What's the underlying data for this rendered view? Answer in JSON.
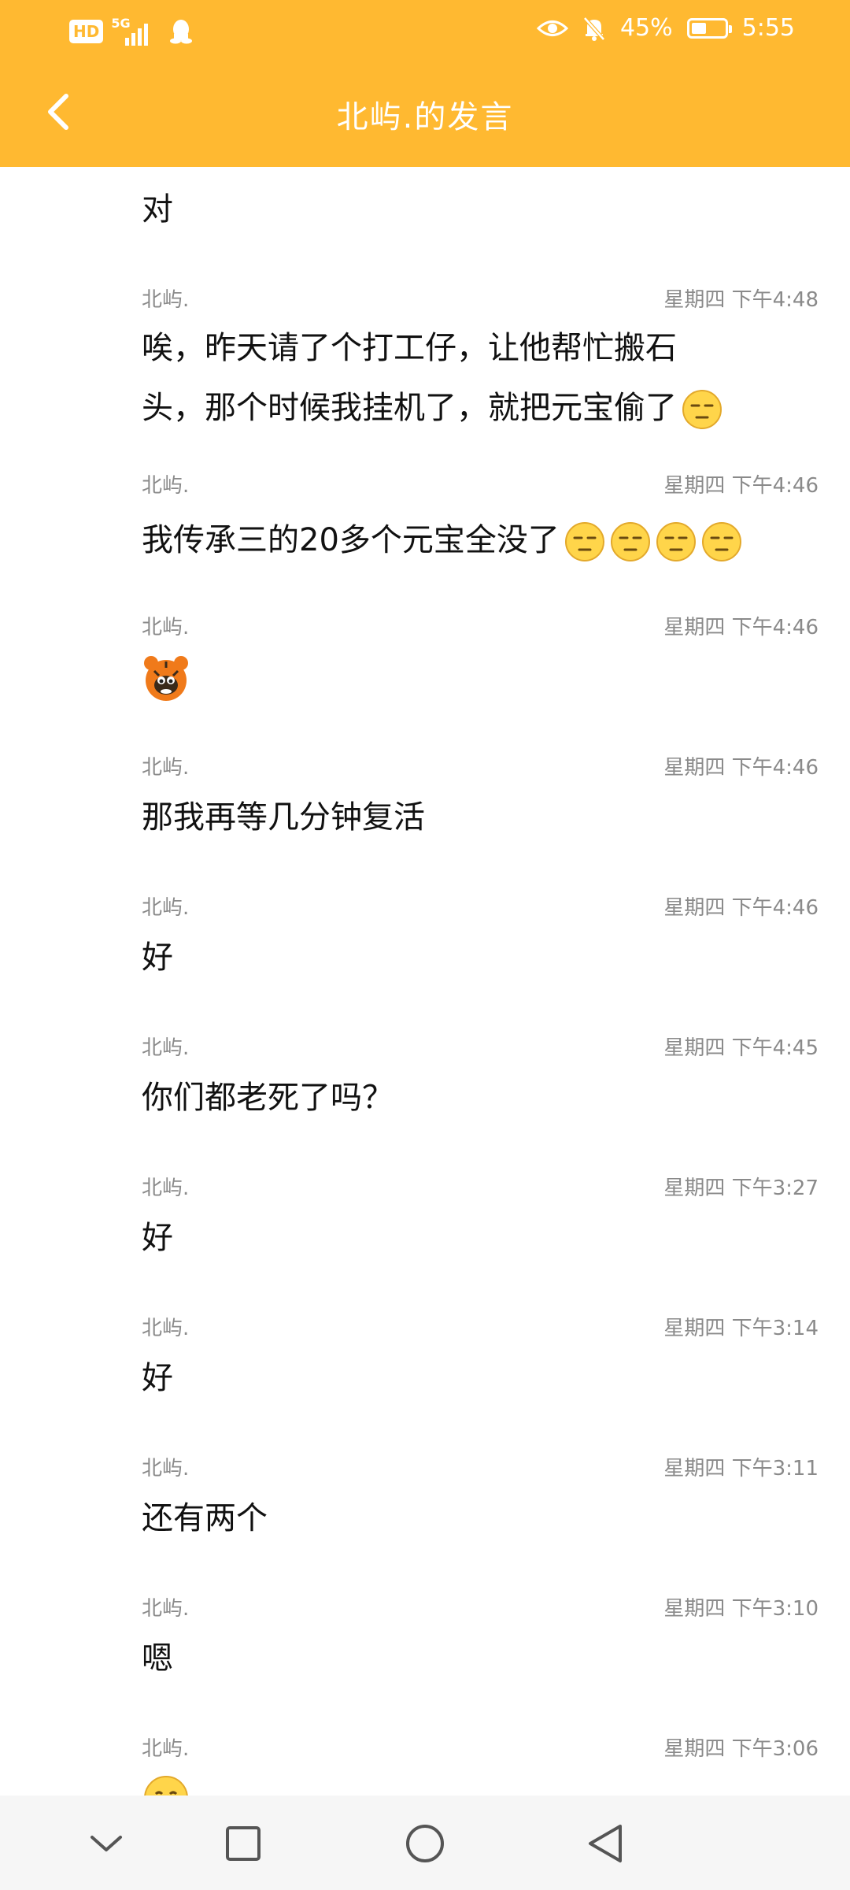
{
  "status_bar": {
    "hd": "HD",
    "network": "5G",
    "battery_percent": "45%",
    "battery_level": 0.45,
    "time": "5:55"
  },
  "header": {
    "title": "北屿.的发言",
    "accent_color": "#FFB931"
  },
  "messages": [
    {
      "name": "",
      "time": "",
      "text": "对"
    },
    {
      "name": "北屿.",
      "time": "星期四 下午4:48",
      "lines": [
        "唉，昨天请了个打工仔，让他帮忙搬石",
        "头，那个时候我挂机了，就把元宝偷了"
      ],
      "emojis": [
        "unamused-face-icon"
      ]
    },
    {
      "name": "北屿.",
      "time": "星期四 下午4:46",
      "text": "我传承三的20多个元宝全没了",
      "emojis": [
        "unamused-face-icon",
        "unamused-face-icon",
        "unamused-face-icon",
        "unamused-face-icon"
      ]
    },
    {
      "name": "北屿.",
      "time": "星期四 下午4:46",
      "sticker": "tiger-sticker-icon"
    },
    {
      "name": "北屿.",
      "time": "星期四 下午4:46",
      "text": "那我再等几分钟复活"
    },
    {
      "name": "北屿.",
      "time": "星期四 下午4:46",
      "text": "好"
    },
    {
      "name": "北屿.",
      "time": "星期四 下午4:45",
      "text": "你们都老死了吗？"
    },
    {
      "name": "北屿.",
      "time": "星期四 下午3:27",
      "text": "好"
    },
    {
      "name": "北屿.",
      "time": "星期四 下午3:14",
      "text": "好"
    },
    {
      "name": "北屿.",
      "time": "星期四 下午3:11",
      "text": "还有两个"
    },
    {
      "name": "北屿.",
      "time": "星期四 下午3:10",
      "text": "嗯"
    },
    {
      "name": "北屿.",
      "time": "星期四 下午3:06",
      "emojis": [
        "smile-face-icon"
      ]
    }
  ],
  "nav": {
    "buttons": [
      "collapse-icon",
      "recent-apps-icon",
      "home-icon",
      "back-icon"
    ]
  }
}
